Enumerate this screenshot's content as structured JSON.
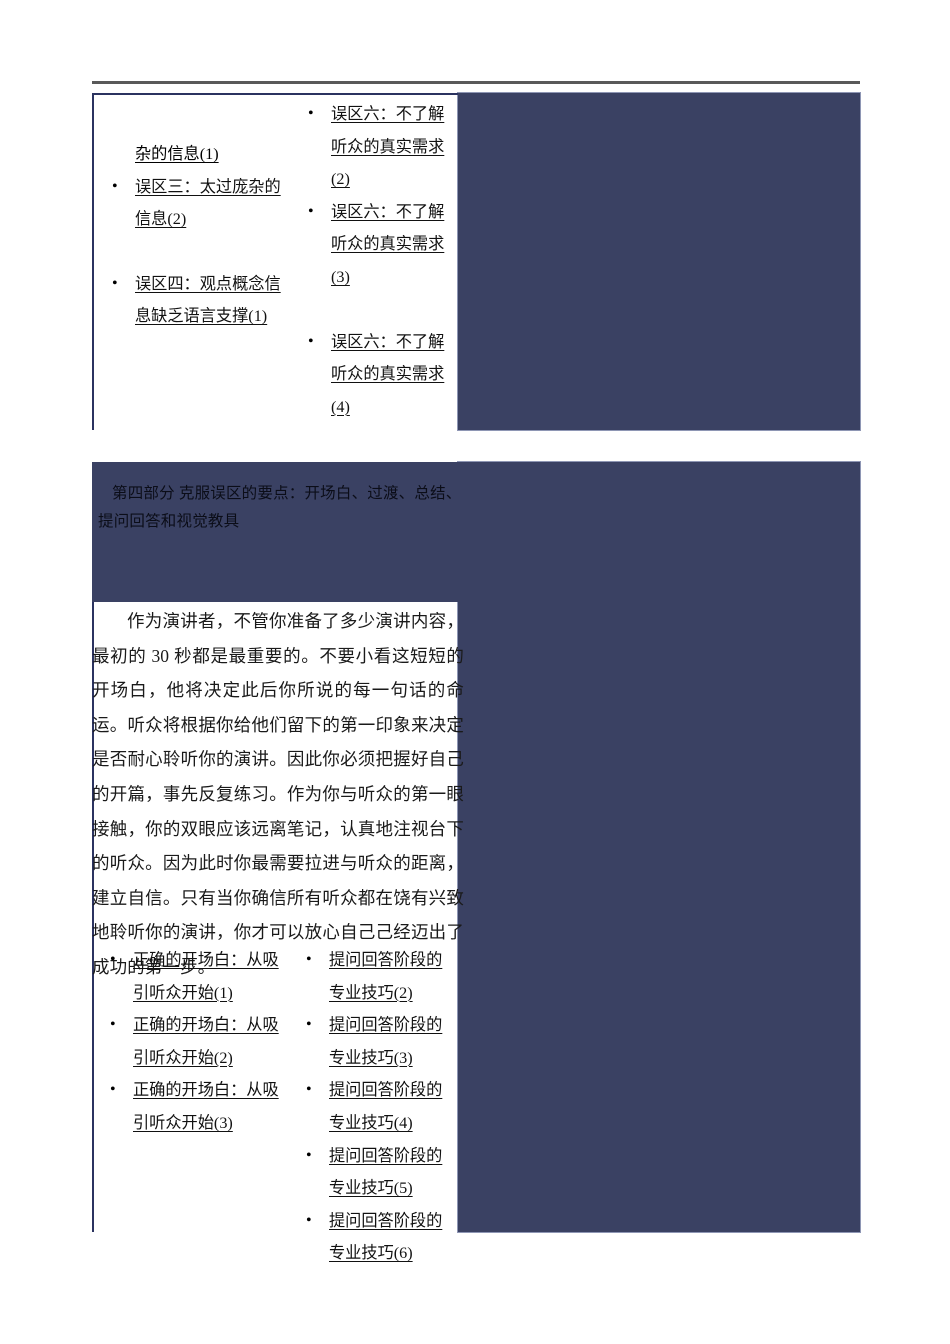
{
  "document": {
    "page_background": "#ffffff",
    "accent_color": "#3a4163",
    "rule_color": "#595959",
    "table_border_color": "#2b3360"
  },
  "table_one": {
    "column_left": {
      "lead_fragment": "杂的信息(1)",
      "items": [
        "误区三：太过庞杂的信息(2)",
        "误区四：观点概念信息缺乏语言支撑(1)"
      ]
    },
    "column_right": {
      "items": [
        "误区六：不了解听众的真实需求(2)",
        "误区六：不了解听众的真实需求(3)",
        "误区六：不了解听众的真实需求(4)"
      ]
    }
  },
  "section": {
    "heading_line1": "第四部分  克服误区的要点：开场白、过渡、总结、",
    "heading_line2": "提问回答和视觉教具",
    "body_paragraph": "作为演讲者，不管你准备了多少演讲内容，最初的 30 秒都是最重要的。不要小看这短短的开场白，他将决定此后你所说的每一句话的命运。听众将根据你给他们留下的第一印象来决定是否耐心聆听你的演讲。因此你必须把握好自己的开篇，事先反复练习。作为你与听众的第一眼接触，你的双眼应该远离笔记，认真地注视台下的听众。因为此时你最需要拉进与听众的距离，建立自信。只有当你确信所有听众都在饶有兴致地聆听你的演讲，你才可以放心自己己经迈出了成功的第一步。"
  },
  "table_two": {
    "column_left": {
      "items": [
        "正确的开场白：从吸引听众开始(1)",
        "正确的开场白：从吸引听众开始(2)",
        "正确的开场白：从吸引听众开始(3)"
      ]
    },
    "column_right": {
      "items": [
        "提问回答阶段的专业技巧(2)",
        "提问回答阶段的专业技巧(3)",
        "提问回答阶段的专业技巧(4)",
        "提问回答阶段的专业技巧(5)",
        "提问回答阶段的专业技巧(6)"
      ]
    }
  }
}
